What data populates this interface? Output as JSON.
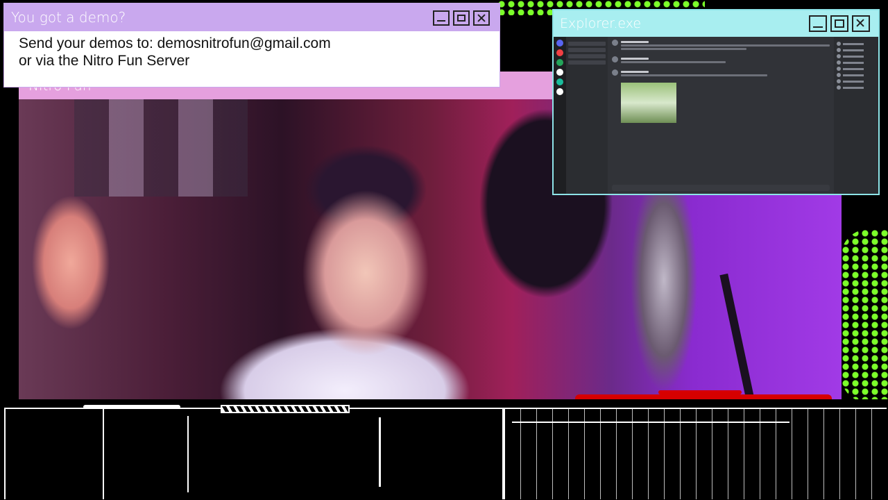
{
  "demo_window": {
    "title": "You got a demo?",
    "line1": "Send your demos to: demosnitrofun@gmail.com",
    "line2": "or via the Nitro Fun Server"
  },
  "stream_window": {
    "title": "Nitro Fun"
  },
  "explorer_window": {
    "title": "Explorer.exe"
  },
  "colors": {
    "demo_titlebar": "#c9a8ee",
    "nitro_titlebar": "#e5a0de",
    "explorer_titlebar": "#a8eef0",
    "accent_green": "#7cff2a",
    "accent_red": "#d60000"
  }
}
